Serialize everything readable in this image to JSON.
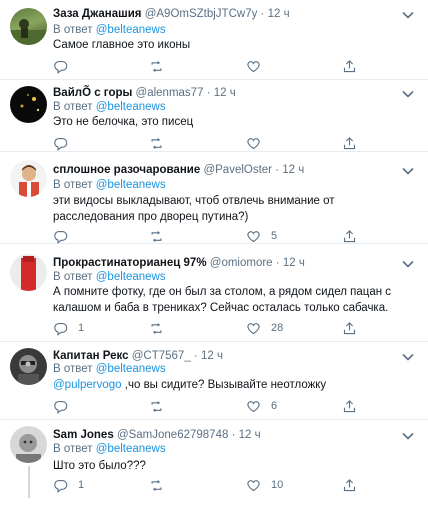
{
  "tweets": [
    {
      "name": "Заза Джанашия",
      "handle": "@A9OmSZtbjJTCw7y",
      "time": "12 ч",
      "reply_label": "В ответ",
      "reply_to": "@belteanews",
      "text": "Самое главное это иконы",
      "counts": {
        "reply": "",
        "retweet": "",
        "like": ""
      }
    },
    {
      "name": "ВайлÕ с горы",
      "handle": "@alenmas77",
      "time": "12 ч",
      "reply_label": "В ответ",
      "reply_to": "@belteanews",
      "text": "Это не белочка, это писец",
      "counts": {
        "reply": "",
        "retweet": "",
        "like": ""
      }
    },
    {
      "name": "сплошное разочарование",
      "handle": "@PavelOster",
      "time": "12 ч",
      "reply_label": "В ответ",
      "reply_to": "@belteanews",
      "text": "эти видосы выкладывают, чтоб отвлечь внимание от расследования про дворец путина?)",
      "counts": {
        "reply": "",
        "retweet": "",
        "like": "5"
      }
    },
    {
      "name": "Прокрастинаторианец 97%",
      "handle": "@omiomore",
      "time": "12 ч",
      "reply_label": "В ответ",
      "reply_to": "@belteanews",
      "text": "А помните фотку, где он был за столом, а рядом сидел пацан с калашом и баба в трениках? Сейчас осталась только сабачка.",
      "counts": {
        "reply": "1",
        "retweet": "",
        "like": "28"
      }
    },
    {
      "name": "Капитан Рекс",
      "handle": "@CT7567_",
      "time": "12 ч",
      "reply_label": "В ответ",
      "reply_to": "@belteanews",
      "mention": "@pulpervogo",
      "text": " ,чо вы сидите? Вызывайте неотложку",
      "counts": {
        "reply": "",
        "retweet": "",
        "like": "6"
      }
    },
    {
      "name": "Sam Jones",
      "handle": "@SamJone62798748",
      "time": "12 ч",
      "reply_label": "В ответ",
      "reply_to": "@belteanews",
      "text": "Што это было???",
      "counts": {
        "reply": "1",
        "retweet": "",
        "like": "10"
      }
    }
  ],
  "separator": "·",
  "icons": {
    "reply": "reply-icon",
    "retweet": "retweet-icon",
    "like": "like-icon",
    "share": "share-icon",
    "more": "chevron-down-icon"
  },
  "colors": {
    "text": "#0f1419",
    "secondary": "#5b7083",
    "link": "#1b95e0",
    "divider": "#e6ecf0"
  }
}
